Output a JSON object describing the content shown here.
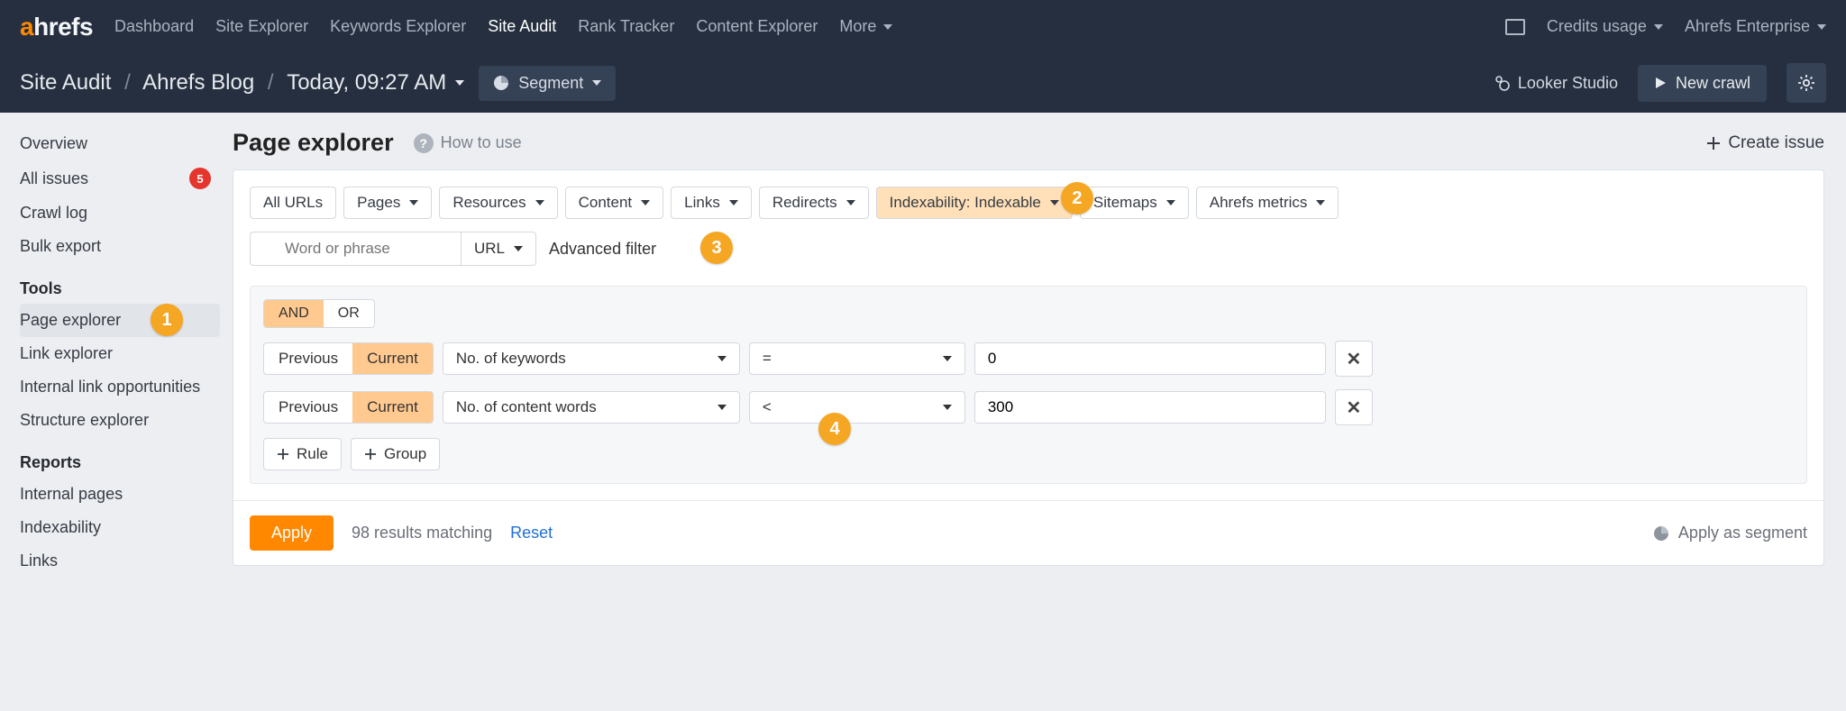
{
  "topnav": {
    "dashboard": "Dashboard",
    "site_explorer": "Site Explorer",
    "keywords_explorer": "Keywords Explorer",
    "site_audit": "Site Audit",
    "rank_tracker": "Rank Tracker",
    "content_explorer": "Content Explorer",
    "more": "More",
    "credits": "Credits usage",
    "account": "Ahrefs Enterprise"
  },
  "crumb": {
    "root": "Site Audit",
    "project": "Ahrefs Blog",
    "timestamp": "Today, 09:27 AM"
  },
  "segment_btn": "Segment",
  "looker": "Looker Studio",
  "new_crawl": "New crawl",
  "sidebar": {
    "overview": "Overview",
    "all_issues": "All issues",
    "all_issues_count": "5",
    "crawl_log": "Crawl log",
    "bulk_export": "Bulk export",
    "tools_head": "Tools",
    "page_explorer": "Page explorer",
    "link_explorer": "Link explorer",
    "internal_link_opp": "Internal link opportunities",
    "structure_explorer": "Structure explorer",
    "reports_head": "Reports",
    "internal_pages": "Internal pages",
    "indexability": "Indexability",
    "links": "Links"
  },
  "page_title": "Page explorer",
  "how_to_use": "How to use",
  "create_issue": "Create issue",
  "filter_tabs": {
    "all_urls": "All URLs",
    "pages": "Pages",
    "resources": "Resources",
    "content": "Content",
    "links": "Links",
    "redirects": "Redirects",
    "indexability": "Indexability: Indexable",
    "sitemaps": "Sitemaps",
    "ahrefs_metrics": "Ahrefs metrics"
  },
  "search": {
    "placeholder": "Word or phrase",
    "scope": "URL",
    "advanced_filter": "Advanced filter"
  },
  "logic": {
    "and": "AND",
    "or": "OR"
  },
  "rules": [
    {
      "prev": "Previous",
      "curr": "Current",
      "metric": "No. of keywords",
      "op": "=",
      "value": "0"
    },
    {
      "prev": "Previous",
      "curr": "Current",
      "metric": "No. of content words",
      "op": "<",
      "value": "300"
    }
  ],
  "add": {
    "rule": "Rule",
    "group": "Group"
  },
  "apply": {
    "btn": "Apply",
    "results": "98 results matching",
    "reset": "Reset",
    "apply_segment": "Apply as segment"
  },
  "callouts": {
    "1": "1",
    "2": "2",
    "3": "3",
    "4": "4"
  }
}
